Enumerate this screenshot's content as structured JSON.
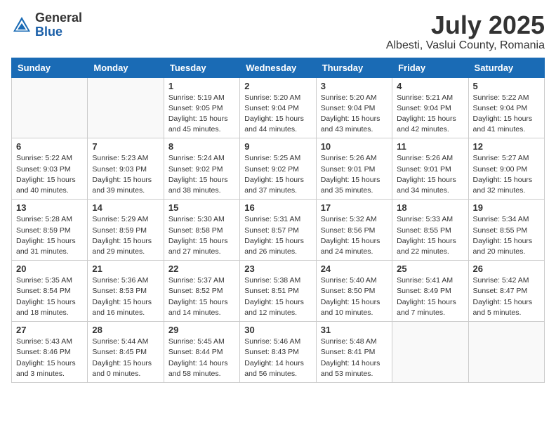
{
  "header": {
    "logo_general": "General",
    "logo_blue": "Blue",
    "month_year": "July 2025",
    "location": "Albesti, Vaslui County, Romania"
  },
  "weekdays": [
    "Sunday",
    "Monday",
    "Tuesday",
    "Wednesday",
    "Thursday",
    "Friday",
    "Saturday"
  ],
  "weeks": [
    [
      {
        "day": "",
        "info": ""
      },
      {
        "day": "",
        "info": ""
      },
      {
        "day": "1",
        "info": "Sunrise: 5:19 AM\nSunset: 9:05 PM\nDaylight: 15 hours and 45 minutes."
      },
      {
        "day": "2",
        "info": "Sunrise: 5:20 AM\nSunset: 9:04 PM\nDaylight: 15 hours and 44 minutes."
      },
      {
        "day": "3",
        "info": "Sunrise: 5:20 AM\nSunset: 9:04 PM\nDaylight: 15 hours and 43 minutes."
      },
      {
        "day": "4",
        "info": "Sunrise: 5:21 AM\nSunset: 9:04 PM\nDaylight: 15 hours and 42 minutes."
      },
      {
        "day": "5",
        "info": "Sunrise: 5:22 AM\nSunset: 9:04 PM\nDaylight: 15 hours and 41 minutes."
      }
    ],
    [
      {
        "day": "6",
        "info": "Sunrise: 5:22 AM\nSunset: 9:03 PM\nDaylight: 15 hours and 40 minutes."
      },
      {
        "day": "7",
        "info": "Sunrise: 5:23 AM\nSunset: 9:03 PM\nDaylight: 15 hours and 39 minutes."
      },
      {
        "day": "8",
        "info": "Sunrise: 5:24 AM\nSunset: 9:02 PM\nDaylight: 15 hours and 38 minutes."
      },
      {
        "day": "9",
        "info": "Sunrise: 5:25 AM\nSunset: 9:02 PM\nDaylight: 15 hours and 37 minutes."
      },
      {
        "day": "10",
        "info": "Sunrise: 5:26 AM\nSunset: 9:01 PM\nDaylight: 15 hours and 35 minutes."
      },
      {
        "day": "11",
        "info": "Sunrise: 5:26 AM\nSunset: 9:01 PM\nDaylight: 15 hours and 34 minutes."
      },
      {
        "day": "12",
        "info": "Sunrise: 5:27 AM\nSunset: 9:00 PM\nDaylight: 15 hours and 32 minutes."
      }
    ],
    [
      {
        "day": "13",
        "info": "Sunrise: 5:28 AM\nSunset: 8:59 PM\nDaylight: 15 hours and 31 minutes."
      },
      {
        "day": "14",
        "info": "Sunrise: 5:29 AM\nSunset: 8:59 PM\nDaylight: 15 hours and 29 minutes."
      },
      {
        "day": "15",
        "info": "Sunrise: 5:30 AM\nSunset: 8:58 PM\nDaylight: 15 hours and 27 minutes."
      },
      {
        "day": "16",
        "info": "Sunrise: 5:31 AM\nSunset: 8:57 PM\nDaylight: 15 hours and 26 minutes."
      },
      {
        "day": "17",
        "info": "Sunrise: 5:32 AM\nSunset: 8:56 PM\nDaylight: 15 hours and 24 minutes."
      },
      {
        "day": "18",
        "info": "Sunrise: 5:33 AM\nSunset: 8:55 PM\nDaylight: 15 hours and 22 minutes."
      },
      {
        "day": "19",
        "info": "Sunrise: 5:34 AM\nSunset: 8:55 PM\nDaylight: 15 hours and 20 minutes."
      }
    ],
    [
      {
        "day": "20",
        "info": "Sunrise: 5:35 AM\nSunset: 8:54 PM\nDaylight: 15 hours and 18 minutes."
      },
      {
        "day": "21",
        "info": "Sunrise: 5:36 AM\nSunset: 8:53 PM\nDaylight: 15 hours and 16 minutes."
      },
      {
        "day": "22",
        "info": "Sunrise: 5:37 AM\nSunset: 8:52 PM\nDaylight: 15 hours and 14 minutes."
      },
      {
        "day": "23",
        "info": "Sunrise: 5:38 AM\nSunset: 8:51 PM\nDaylight: 15 hours and 12 minutes."
      },
      {
        "day": "24",
        "info": "Sunrise: 5:40 AM\nSunset: 8:50 PM\nDaylight: 15 hours and 10 minutes."
      },
      {
        "day": "25",
        "info": "Sunrise: 5:41 AM\nSunset: 8:49 PM\nDaylight: 15 hours and 7 minutes."
      },
      {
        "day": "26",
        "info": "Sunrise: 5:42 AM\nSunset: 8:47 PM\nDaylight: 15 hours and 5 minutes."
      }
    ],
    [
      {
        "day": "27",
        "info": "Sunrise: 5:43 AM\nSunset: 8:46 PM\nDaylight: 15 hours and 3 minutes."
      },
      {
        "day": "28",
        "info": "Sunrise: 5:44 AM\nSunset: 8:45 PM\nDaylight: 15 hours and 0 minutes."
      },
      {
        "day": "29",
        "info": "Sunrise: 5:45 AM\nSunset: 8:44 PM\nDaylight: 14 hours and 58 minutes."
      },
      {
        "day": "30",
        "info": "Sunrise: 5:46 AM\nSunset: 8:43 PM\nDaylight: 14 hours and 56 minutes."
      },
      {
        "day": "31",
        "info": "Sunrise: 5:48 AM\nSunset: 8:41 PM\nDaylight: 14 hours and 53 minutes."
      },
      {
        "day": "",
        "info": ""
      },
      {
        "day": "",
        "info": ""
      }
    ]
  ]
}
